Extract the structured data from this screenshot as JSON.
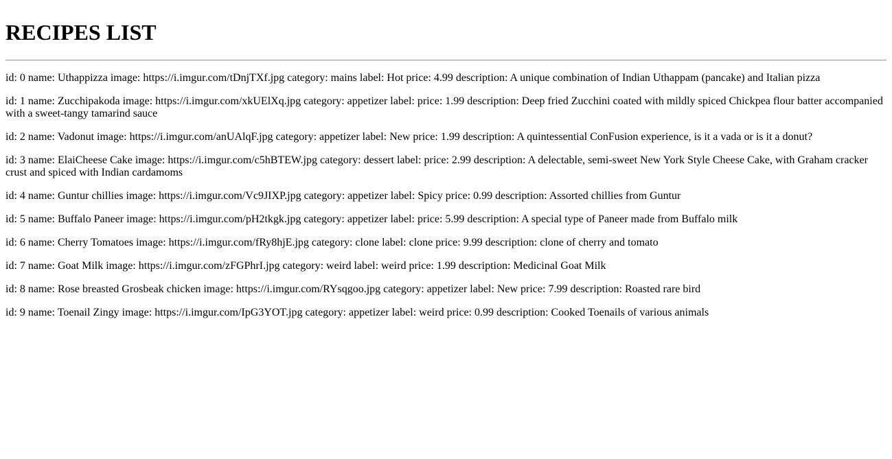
{
  "page": {
    "title": "RECIPES LIST"
  },
  "recipes": [
    {
      "text": "id: 0 name: Uthappizza image: https://i.imgur.com/tDnjTXf.jpg category: mains label: Hot price: 4.99 description: A unique combination of Indian Uthappam (pancake) and Italian pizza"
    },
    {
      "text": "id: 1 name: Zucchipakoda image: https://i.imgur.com/xkUElXq.jpg category: appetizer label: price: 1.99 description: Deep fried Zucchini coated with mildly spiced Chickpea flour batter accompanied with a sweet-tangy tamarind sauce"
    },
    {
      "text": "id: 2 name: Vadonut image: https://i.imgur.com/anUAlqF.jpg category: appetizer label: New price: 1.99 description: A quintessential ConFusion experience, is it a vada or is it a donut?"
    },
    {
      "text": "id: 3 name: ElaiCheese Cake image: https://i.imgur.com/c5hBTEW.jpg category: dessert label: price: 2.99 description: A delectable, semi-sweet New York Style Cheese Cake, with Graham cracker crust and spiced with Indian cardamoms"
    },
    {
      "text": "id: 4 name: Guntur chillies image: https://i.imgur.com/Vc9JIXP.jpg category: appetizer label: Spicy price: 0.99 description: Assorted chillies from Guntur"
    },
    {
      "text": "id: 5 name: Buffalo Paneer image: https://i.imgur.com/pH2tkgk.jpg category: appetizer label: price: 5.99 description: A special type of Paneer made from Buffalo milk"
    },
    {
      "text": "id: 6 name: Cherry Tomatoes image: https://i.imgur.com/fRy8hjE.jpg category: clone label: clone price: 9.99 description: clone of cherry and tomato"
    },
    {
      "text": "id: 7 name: Goat Milk image: https://i.imgur.com/zFGPhrI.jpg category: weird label: weird price: 1.99 description: Medicinal Goat Milk"
    },
    {
      "text": "id: 8 name: Rose breasted Grosbeak chicken image: https://i.imgur.com/RYsqgoo.jpg category: appetizer label: New price: 7.99 description: Roasted rare bird"
    },
    {
      "text": "id: 9 name: Toenail Zingy image: https://i.imgur.com/IpG3YOT.jpg category: appetizer label: weird price: 0.99 description: Cooked Toenails of various animals"
    }
  ]
}
